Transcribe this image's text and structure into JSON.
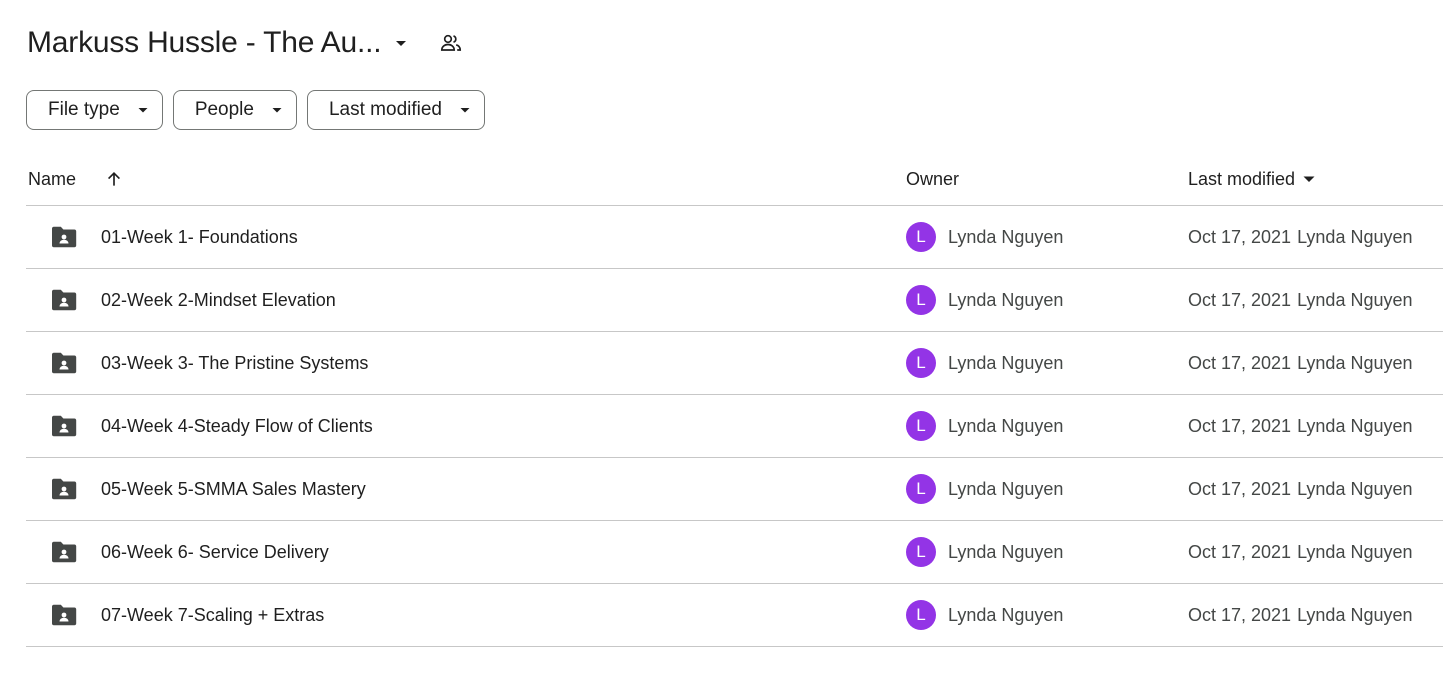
{
  "header": {
    "title": "Markuss Hussle - The Au...",
    "title_caret_icon": "arrow-drop-down-icon",
    "share_icon": "people-icon"
  },
  "filters": [
    {
      "label": "File type",
      "icon": "arrow-drop-down-icon"
    },
    {
      "label": "People",
      "icon": "arrow-drop-down-icon"
    },
    {
      "label": "Last modified",
      "icon": "arrow-drop-down-icon"
    }
  ],
  "table": {
    "columns": {
      "name": "Name",
      "owner": "Owner",
      "last_modified": "Last modified"
    },
    "sort_icon": "arrow-upward-icon",
    "rows": [
      {
        "name": "01-Week 1- Foundations",
        "owner_initial": "L",
        "owner": "Lynda Nguyen",
        "modified_date": "Oct 17, 2021",
        "modified_by": "Lynda Nguyen"
      },
      {
        "name": "02-Week 2-Mindset Elevation",
        "owner_initial": "L",
        "owner": "Lynda Nguyen",
        "modified_date": "Oct 17, 2021",
        "modified_by": "Lynda Nguyen"
      },
      {
        "name": "03-Week 3- The Pristine Systems",
        "owner_initial": "L",
        "owner": "Lynda Nguyen",
        "modified_date": "Oct 17, 2021",
        "modified_by": "Lynda Nguyen"
      },
      {
        "name": "04-Week 4-Steady Flow of Clients",
        "owner_initial": "L",
        "owner": "Lynda Nguyen",
        "modified_date": "Oct 17, 2021",
        "modified_by": "Lynda Nguyen"
      },
      {
        "name": "05-Week 5-SMMA Sales Mastery",
        "owner_initial": "L",
        "owner": "Lynda Nguyen",
        "modified_date": "Oct 17, 2021",
        "modified_by": "Lynda Nguyen"
      },
      {
        "name": "06-Week 6- Service Delivery",
        "owner_initial": "L",
        "owner": "Lynda Nguyen",
        "modified_date": "Oct 17, 2021",
        "modified_by": "Lynda Nguyen"
      },
      {
        "name": "07-Week 7-Scaling + Extras",
        "owner_initial": "L",
        "owner": "Lynda Nguyen",
        "modified_date": "Oct 17, 2021",
        "modified_by": "Lynda Nguyen"
      }
    ]
  },
  "colors": {
    "avatar": "#9334e6",
    "icon": "#444746",
    "divider": "#c7c7c7",
    "chip_border": "#747775"
  }
}
